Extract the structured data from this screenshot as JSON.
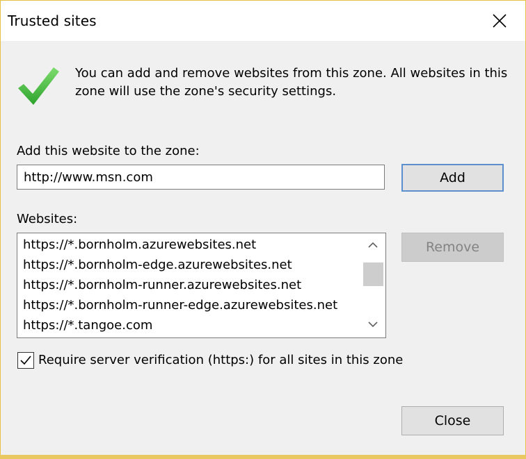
{
  "window": {
    "title": "Trusted sites"
  },
  "intro": {
    "text": "You can add and remove websites from this zone. All websites in this zone will use the zone's security settings."
  },
  "add_section": {
    "label": "Add this website to the zone:",
    "value": "http://www.msn.com",
    "add_button": "Add"
  },
  "websites": {
    "label": "Websites:",
    "items": [
      "https://*.bornholm.azurewebsites.net",
      "https://*.bornholm-edge.azurewebsites.net",
      "https://*.bornholm-runner.azurewebsites.net",
      "https://*.bornholm-runner-edge.azurewebsites.net",
      "https://*.tangoe.com"
    ],
    "remove_button": "Remove"
  },
  "verification": {
    "checked": true,
    "label": "Require server verification (https:) for all sites in this zone"
  },
  "footer": {
    "close_button": "Close"
  },
  "icons": {
    "check": "checkmark-icon",
    "close": "close-icon"
  },
  "colors": {
    "check": "#3fbf3f",
    "accent_border": "#5b8fd0",
    "frame_edge": "#e8bf45"
  }
}
